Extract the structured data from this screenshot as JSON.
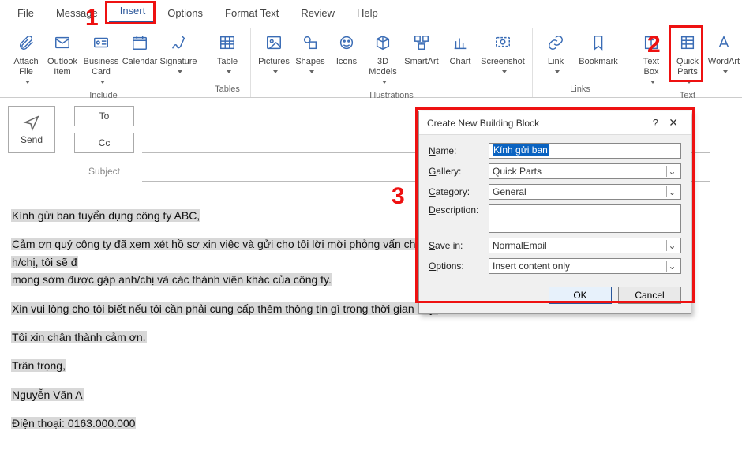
{
  "tabs": {
    "file": "File",
    "message": "Message",
    "insert": "Insert",
    "options": "Options",
    "format_text": "Format Text",
    "review": "Review",
    "help": "Help"
  },
  "ribbon_groups": {
    "include": {
      "label": "Include",
      "attach_file": "Attach\nFile",
      "outlook_item": "Outlook\nItem",
      "business_card": "Business\nCard",
      "calendar": "Calendar",
      "signature": "Signature"
    },
    "tables": {
      "label": "Tables",
      "table": "Table"
    },
    "illustrations": {
      "label": "Illustrations",
      "pictures": "Pictures",
      "shapes": "Shapes",
      "icons": "Icons",
      "models": "3D\nModels",
      "smartart": "SmartArt",
      "chart": "Chart",
      "screenshot": "Screenshot"
    },
    "links": {
      "label": "Links",
      "link": "Link",
      "bookmark": "Bookmark"
    },
    "text": {
      "label": "Text",
      "text_box": "Text\nBox",
      "quick_parts": "Quick\nParts",
      "wordart": "WordArt"
    }
  },
  "compose": {
    "send": "Send",
    "to": "To",
    "cc": "Cc",
    "subject_label": "Subject"
  },
  "body": {
    "l1": "Kính gửi ban tuyển dụng công ty ABC,",
    "l2a": "Cảm ơn quý công ty đã xem xét hồ sơ xin việc và gửi cho tôi lời mời phỏng vấn cho vị trí",
    "l2b": "h/chị, tôi sẽ đ",
    "l3": "mong sớm được gặp anh/chị và các thành viên khác của công ty.",
    "l4": "Xin vui lòng cho tôi biết nếu tôi cần phải cung cấp thêm thông tin gì trong thời gian này.",
    "l5": "Tôi xin chân thành cảm ơn.",
    "l6": "Trân trọng,",
    "l7": "Nguyễn Văn A",
    "l8": "Điện thoại: 0163.000.000"
  },
  "dialog": {
    "title": "Create New Building Block",
    "name_lbl": "Name:",
    "name_val": "Kính gửi ban",
    "gallery_lbl": "Gallery:",
    "gallery_val": "Quick Parts",
    "category_lbl": "Category:",
    "category_val": "General",
    "description_lbl": "Description:",
    "savein_lbl": "Save in:",
    "savein_val": "NormalEmail",
    "options_lbl": "Options:",
    "options_val": "Insert content only",
    "ok": "OK",
    "cancel": "Cancel"
  },
  "annotations": {
    "n1": "1",
    "n2": "2",
    "n3": "3"
  }
}
